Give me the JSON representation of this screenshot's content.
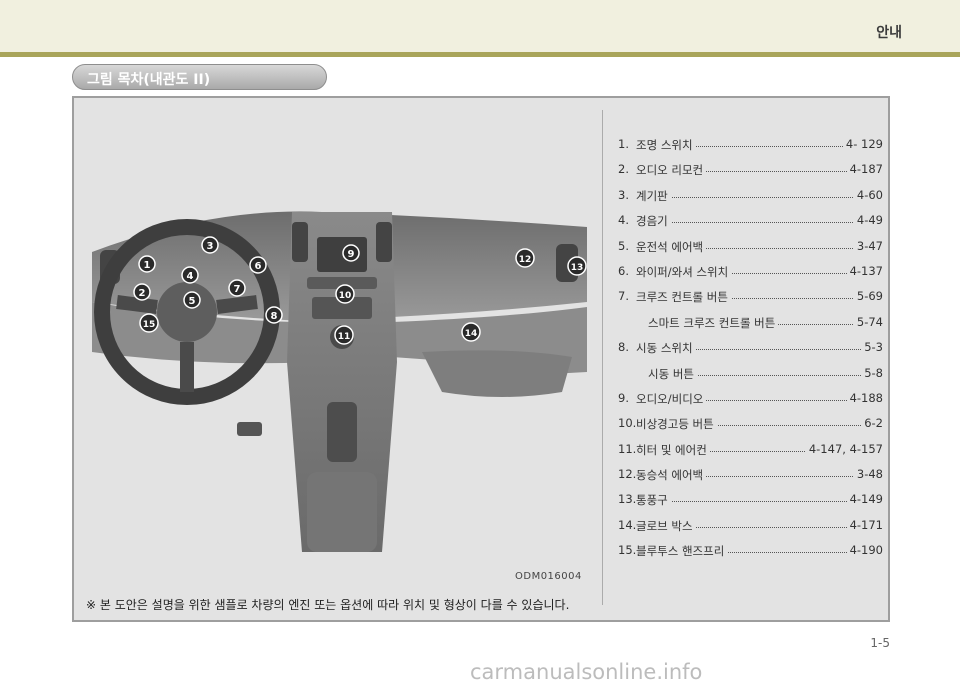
{
  "header": {
    "section_title": "안내"
  },
  "title_bar": {
    "label": "그림 목차(내관도 II)"
  },
  "figure": {
    "code": "ODM016004",
    "callouts": [
      "1",
      "2",
      "3",
      "4",
      "5",
      "6",
      "7",
      "8",
      "9",
      "10",
      "11",
      "12",
      "13",
      "14",
      "15"
    ]
  },
  "note": "※ 본 도안은 설명을 위한 샘플로 차량의 엔진 또는 옵션에 따라 위치 및 형상이 다를 수 있습니다.",
  "toc": [
    {
      "num": "1.",
      "label": "조명 스위치",
      "page": "4- 129"
    },
    {
      "num": "2.",
      "label": "오디오 리모컨",
      "page": "4-187"
    },
    {
      "num": "3.",
      "label": "계기판",
      "page": "4-60"
    },
    {
      "num": "4.",
      "label": "경음기",
      "page": "4-49"
    },
    {
      "num": "5.",
      "label": "운전석 에어백",
      "page": "3-47"
    },
    {
      "num": "6.",
      "label": "와이퍼/와셔 스위치",
      "page": "4-137"
    },
    {
      "num": "7.",
      "label": "크루즈 컨트롤 버튼",
      "page": "5-69"
    },
    {
      "num": "",
      "label": "스마트 크루즈 컨트롤 버튼",
      "page": "5-74"
    },
    {
      "num": "8.",
      "label": "시동 스위치",
      "page": "5-3"
    },
    {
      "num": "",
      "label": "시동 버튼",
      "page": "5-8"
    },
    {
      "num": "9.",
      "label": "오디오/비디오",
      "page": "4-188"
    },
    {
      "num": "10.",
      "label": "비상경고등 버튼",
      "page": "6-2"
    },
    {
      "num": "11.",
      "label": "히터 및 에어컨",
      "page": "4-147, 4-157"
    },
    {
      "num": "12.",
      "label": "동승석 에어백",
      "page": "3-48"
    },
    {
      "num": "13.",
      "label": "통풍구",
      "page": "4-149"
    },
    {
      "num": "14.",
      "label": "글로브 박스",
      "page": "4-171"
    },
    {
      "num": "15.",
      "label": "블루투스 핸즈프리",
      "page": "4-190"
    }
  ],
  "footer": {
    "page_number": "1-5",
    "watermark": "carmanualsonline.info"
  }
}
